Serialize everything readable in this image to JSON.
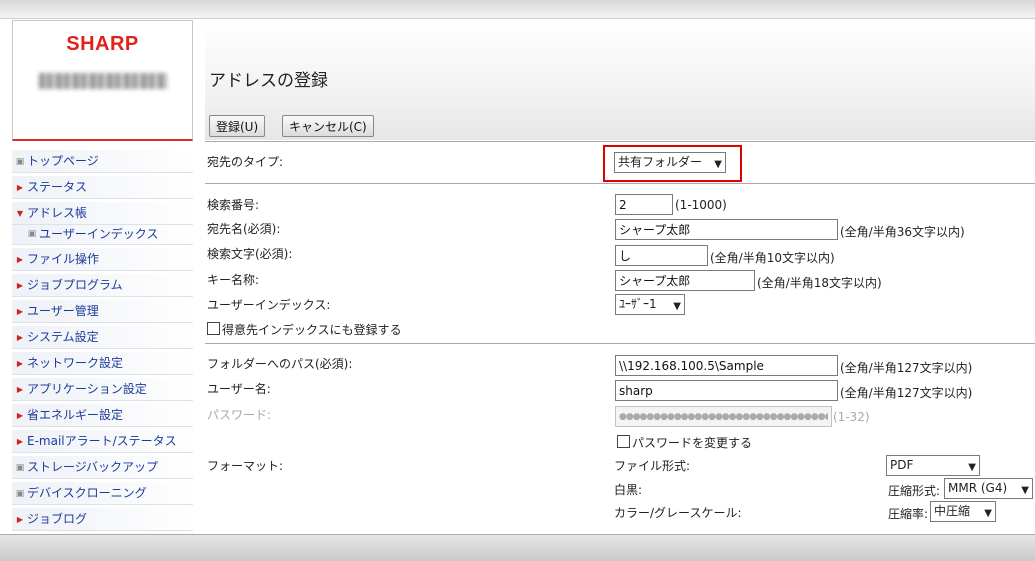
{
  "brand": {
    "logo": "SHARP"
  },
  "sidebar": {
    "items": [
      {
        "label": "トップページ",
        "marker": "square"
      },
      {
        "label": "ステータス",
        "marker": "arrow"
      },
      {
        "label": "アドレス帳",
        "marker": "down"
      },
      {
        "label": "ユーザーインデックス",
        "marker": "square",
        "sub": true
      },
      {
        "label": "ファイル操作",
        "marker": "arrow"
      },
      {
        "label": "ジョブプログラム",
        "marker": "arrow"
      },
      {
        "label": "ユーザー管理",
        "marker": "arrow"
      },
      {
        "label": "システム設定",
        "marker": "arrow"
      },
      {
        "label": "ネットワーク設定",
        "marker": "arrow"
      },
      {
        "label": "アプリケーション設定",
        "marker": "arrow"
      },
      {
        "label": "省エネルギー設定",
        "marker": "arrow"
      },
      {
        "label": "E-mailアラート/ステータス",
        "marker": "arrow"
      },
      {
        "label": "ストレージバックアップ",
        "marker": "square"
      },
      {
        "label": "デバイスクローニング",
        "marker": "square"
      },
      {
        "label": "ジョブログ",
        "marker": "arrow"
      }
    ]
  },
  "main": {
    "title": "アドレスの登録",
    "register_button": "登録(U)",
    "cancel_button": "キャンセル(C)"
  },
  "form": {
    "dest_type": {
      "label": "宛先のタイプ:",
      "value": "共有フォルダー"
    },
    "search_no": {
      "label": "検索番号:",
      "value": "2",
      "note": "(1-1000)"
    },
    "dest_name": {
      "label": "宛先名(必須):",
      "value": "シャープ太郎",
      "note": "(全角/半角36文字以内)"
    },
    "search_char": {
      "label": "検索文字(必須):",
      "value": "し",
      "note": "(全角/半角10文字以内)"
    },
    "key_name": {
      "label": "キー名称:",
      "value": "シャープ太郎",
      "note": "(全角/半角18文字以内)"
    },
    "user_index": {
      "label": "ユーザーインデックス:",
      "value": "ﾕｰｻﾞｰ1"
    },
    "favorite": {
      "label": "得意先インデックスにも登録する"
    },
    "folder_path": {
      "label": "フォルダーへのパス(必須):",
      "value": "\\\\192.168.100.5\\Sample",
      "note": "(全角/半角127文字以内)"
    },
    "username": {
      "label": "ユーザー名:",
      "value": "sharp",
      "note": "(全角/半角127文字以内)"
    },
    "password": {
      "label": "パスワード:",
      "value": "●●●●●●●●●●●●●●●●●●●●●●●●●●●●●●●●●",
      "note": "(1-32)"
    },
    "change_password": {
      "label": "パスワードを変更する"
    },
    "format": {
      "label": "フォーマット:",
      "file_type_label": "ファイル形式:",
      "file_type_value": "PDF",
      "mono_label": "白黒:",
      "compression_label": "圧縮形式:",
      "compression_value": "MMR (G4)",
      "color_label": "カラー/グレースケール:",
      "ratio_label": "圧縮率:",
      "ratio_value": "中圧縮"
    }
  }
}
